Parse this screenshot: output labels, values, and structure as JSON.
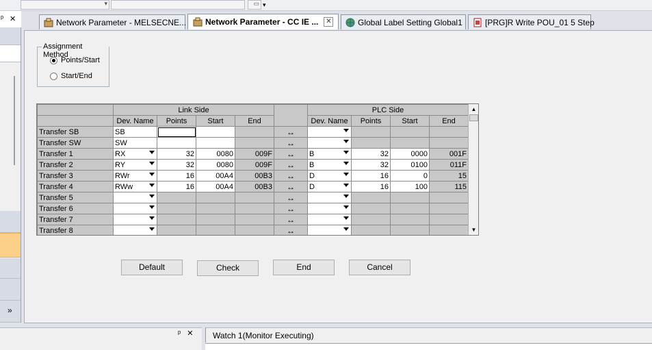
{
  "tabs": [
    {
      "label": "Network Parameter - MELSECNE...",
      "icon": "network-parameter-icon",
      "active": false
    },
    {
      "label": "Network Parameter - CC IE ...",
      "icon": "network-parameter-icon",
      "active": true,
      "close": "✕"
    },
    {
      "label": "Global Label Setting Global1",
      "icon": "globe-icon",
      "active": false
    },
    {
      "label": "[PRG]R Write POU_01 5 Step",
      "icon": "program-icon",
      "active": false
    }
  ],
  "left_panel": {
    "pin": "ᵖ",
    "close": "✕",
    "collapse": "»"
  },
  "assignment": {
    "legend": "Assignment Method",
    "options": [
      {
        "label": "Points/Start",
        "checked": true
      },
      {
        "label": "Start/End",
        "checked": false
      }
    ]
  },
  "grid": {
    "group_headers": {
      "link": "Link Side",
      "plc": "PLC Side"
    },
    "columns": {
      "link": [
        "Dev. Name",
        "Points",
        "Start",
        "End"
      ],
      "plc": [
        "Dev. Name",
        "Points",
        "Start",
        "End"
      ]
    },
    "arrow": "↔",
    "rows": [
      {
        "name": "Transfer SB",
        "link": {
          "dev": "SB",
          "points": "",
          "start": "",
          "end": ""
        },
        "plc": {
          "dev": "",
          "points": "",
          "start": "",
          "end": ""
        }
      },
      {
        "name": "Transfer SW",
        "link": {
          "dev": "SW",
          "points": "",
          "start": "",
          "end": ""
        },
        "plc": {
          "dev": "",
          "points": "",
          "start": "",
          "end": ""
        }
      },
      {
        "name": "Transfer 1",
        "link": {
          "dev": "RX",
          "points": "32",
          "start": "0080",
          "end": "009F"
        },
        "plc": {
          "dev": "B",
          "points": "32",
          "start": "0000",
          "end": "001F"
        }
      },
      {
        "name": "Transfer 2",
        "link": {
          "dev": "RY",
          "points": "32",
          "start": "0080",
          "end": "009F"
        },
        "plc": {
          "dev": "B",
          "points": "32",
          "start": "0100",
          "end": "011F"
        }
      },
      {
        "name": "Transfer 3",
        "link": {
          "dev": "RWr",
          "points": "16",
          "start": "00A4",
          "end": "00B3"
        },
        "plc": {
          "dev": "D",
          "points": "16",
          "start": "0",
          "end": "15"
        }
      },
      {
        "name": "Transfer 4",
        "link": {
          "dev": "RWw",
          "points": "16",
          "start": "00A4",
          "end": "00B3"
        },
        "plc": {
          "dev": "D",
          "points": "16",
          "start": "100",
          "end": "115"
        }
      },
      {
        "name": "Transfer 5",
        "link": {
          "dev": "",
          "points": "",
          "start": "",
          "end": ""
        },
        "plc": {
          "dev": "",
          "points": "",
          "start": "",
          "end": ""
        }
      },
      {
        "name": "Transfer 6",
        "link": {
          "dev": "",
          "points": "",
          "start": "",
          "end": ""
        },
        "plc": {
          "dev": "",
          "points": "",
          "start": "",
          "end": ""
        }
      },
      {
        "name": "Transfer 7",
        "link": {
          "dev": "",
          "points": "",
          "start": "",
          "end": ""
        },
        "plc": {
          "dev": "",
          "points": "",
          "start": "",
          "end": ""
        }
      },
      {
        "name": "Transfer 8",
        "link": {
          "dev": "",
          "points": "",
          "start": "",
          "end": ""
        },
        "plc": {
          "dev": "",
          "points": "",
          "start": "",
          "end": ""
        }
      }
    ]
  },
  "buttons": {
    "default": "Default",
    "check": "Check",
    "end": "End",
    "cancel": "Cancel"
  },
  "watch": {
    "title": "Watch 1(Monitor Executing)",
    "pin": "ᵖ",
    "close": "✕"
  }
}
